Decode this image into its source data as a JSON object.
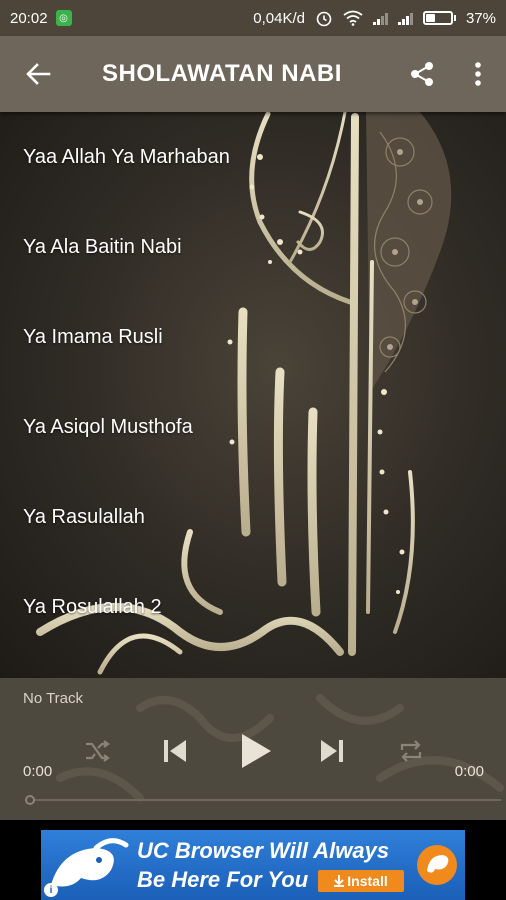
{
  "status_bar": {
    "time": "20:02",
    "speed": "0,04K/d",
    "battery": "37%",
    "battery_level": 0.37
  },
  "app_bar": {
    "title": "SHOLAWATAN NABI",
    "back_icon": "arrow-left-icon",
    "share_icon": "share-icon",
    "menu_icon": "more-vert-icon"
  },
  "tracks": [
    "Yaa Allah Ya Marhaban",
    "Ya Ala Baitin Nabi",
    "Ya Imama Rusli",
    "Ya Asiqol Musthofa",
    "Ya Rasulallah",
    "Ya Rosulallah 2"
  ],
  "player": {
    "track_label": "No Track",
    "time_elapsed": "0:00",
    "time_total": "0:00",
    "progress": 0,
    "icons": [
      "shuffle-icon",
      "skip-previous-icon",
      "play-icon",
      "skip-next-icon",
      "repeat-icon"
    ]
  },
  "ad": {
    "line1": "UC Browser Will Always",
    "line2": "Be Here For You",
    "install_label": "Install",
    "info_label": "i"
  },
  "colors": {
    "status_bar": "#4d4539",
    "app_bar": "#6e665a",
    "player": "#4e493f",
    "ad_blue": "#1b5fb8",
    "ad_orange": "#f08a1c"
  }
}
